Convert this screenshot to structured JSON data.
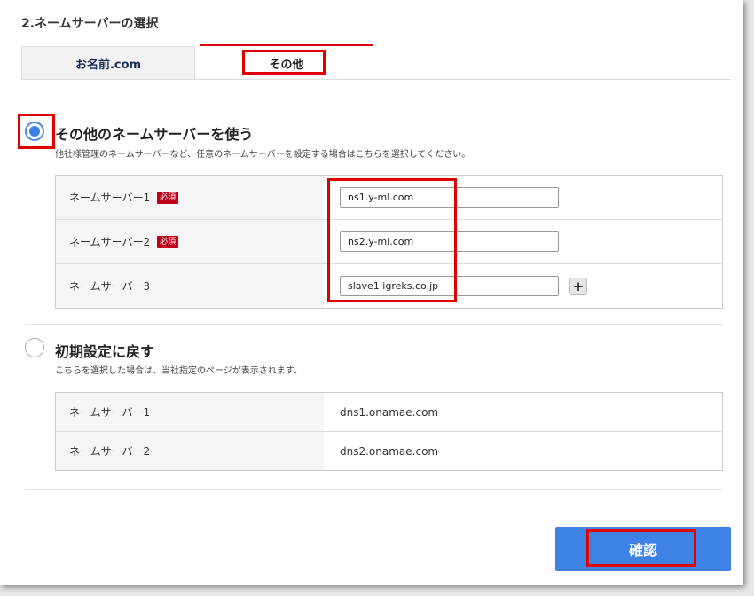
{
  "section": {
    "title": "2.ネームサーバーの選択"
  },
  "tabs": [
    {
      "label": "お名前.com",
      "active": false
    },
    {
      "label": "その他",
      "active": true
    }
  ],
  "option_other": {
    "title": "その他のネームサーバーを使う",
    "desc": "他社様管理のネームサーバーなど、任意のネームサーバーを設定する場合はこちらを選択してください。",
    "selected": true,
    "rows": [
      {
        "label": "ネームサーバー1",
        "required": "必須",
        "value": "ns1.y-ml.com"
      },
      {
        "label": "ネームサーバー2",
        "required": "必須",
        "value": "ns2.y-ml.com"
      },
      {
        "label": "ネームサーバー3",
        "value": "slave1.igreks.co.jp"
      }
    ],
    "add_icon": "plus-icon"
  },
  "option_default": {
    "title": "初期設定に戻す",
    "desc": "こちらを選択した場合は、当社指定のページが表示されます。",
    "selected": false,
    "rows": [
      {
        "label": "ネームサーバー1",
        "value": "dns1.onamae.com"
      },
      {
        "label": "ネームサーバー2",
        "value": "dns2.onamae.com"
      }
    ]
  },
  "confirm": {
    "label": "確認"
  },
  "colors": {
    "accent": "#3f82e6",
    "highlight": "#e10000",
    "required_badge": "#c0001a"
  }
}
